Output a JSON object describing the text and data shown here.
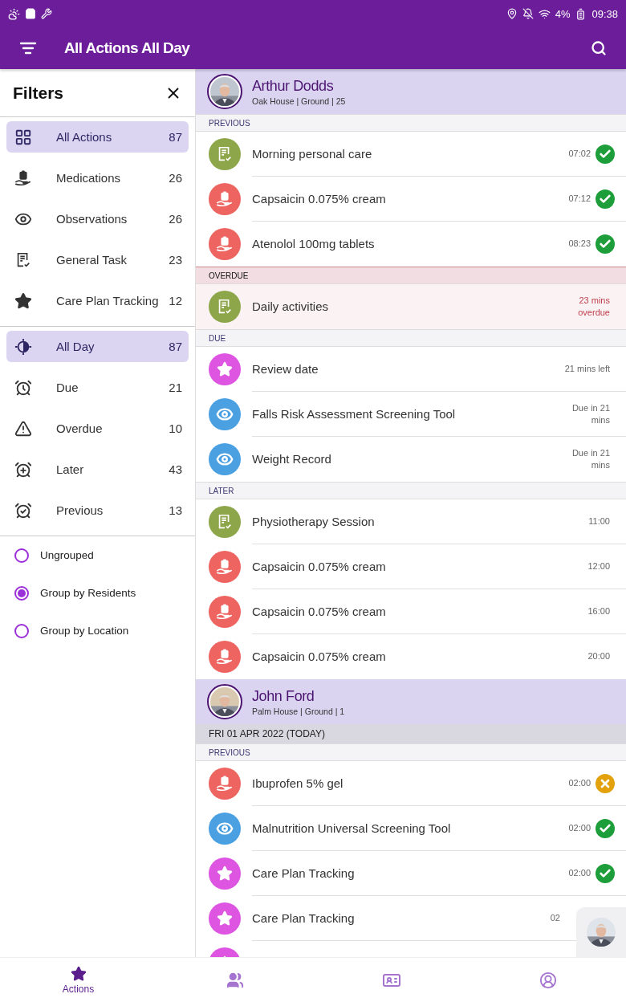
{
  "status_bar": {
    "battery": "4%",
    "time": "09:38"
  },
  "app_bar": {
    "title": "All Actions All Day"
  },
  "filters": {
    "title": "Filters",
    "type_filters": [
      {
        "kind": "all",
        "label": "All Actions",
        "count": "87",
        "selected": true
      },
      {
        "kind": "medication",
        "label": "Medications",
        "count": "26",
        "selected": false
      },
      {
        "kind": "observation",
        "label": "Observations",
        "count": "26",
        "selected": false
      },
      {
        "kind": "task",
        "label": "General Task",
        "count": "23",
        "selected": false
      },
      {
        "kind": "tracking",
        "label": "Care Plan Tracking",
        "count": "12",
        "selected": false
      }
    ],
    "time_filters": [
      {
        "kind": "allday",
        "label": "All Day",
        "count": "87",
        "selected": true
      },
      {
        "kind": "due",
        "label": "Due",
        "count": "21",
        "selected": false
      },
      {
        "kind": "overdue",
        "label": "Overdue",
        "count": "10",
        "selected": false
      },
      {
        "kind": "later",
        "label": "Later",
        "count": "43",
        "selected": false
      },
      {
        "kind": "previous",
        "label": "Previous",
        "count": "13",
        "selected": false
      }
    ],
    "grouping": [
      {
        "label": "Ungrouped",
        "selected": false
      },
      {
        "label": "Group by Residents",
        "selected": true
      },
      {
        "label": "Group by Location",
        "selected": false
      }
    ]
  },
  "residents": [
    {
      "name": "Arthur Dodds",
      "location": "Oak House | Ground | 25",
      "sections": [
        {
          "label": "PREVIOUS",
          "kind": "previous",
          "items": [
            {
              "kind": "task",
              "title": "Morning personal care",
              "time": "07:02",
              "completed": true
            },
            {
              "kind": "medication",
              "title": "Capsaicin 0.075% cream",
              "time": "07:12",
              "completed": true
            },
            {
              "kind": "medication",
              "title": "Atenolol 100mg tablets",
              "time": "08:23",
              "completed": true
            }
          ]
        },
        {
          "label": "OVERDUE",
          "kind": "overdue",
          "items": [
            {
              "kind": "task",
              "title": "Daily activities",
              "time": "23 mins overdue"
            }
          ]
        },
        {
          "label": "DUE",
          "kind": "due",
          "items": [
            {
              "kind": "tracking",
              "title": "Review date",
              "time": "21 mins left"
            },
            {
              "kind": "observation",
              "title": "Falls Risk Assessment Screening Tool",
              "time": "Due in 21 mins"
            },
            {
              "kind": "observation",
              "title": "Weight Record",
              "time": "Due in 21 mins"
            }
          ]
        },
        {
          "label": "LATER",
          "kind": "later",
          "items": [
            {
              "kind": "task",
              "title": "Physiotherapy Session",
              "time": "11:00"
            },
            {
              "kind": "medication",
              "title": "Capsaicin 0.075% cream",
              "time": "12:00"
            },
            {
              "kind": "medication",
              "title": "Capsaicin 0.075% cream",
              "time": "16:00"
            },
            {
              "kind": "medication",
              "title": "Capsaicin 0.075% cream",
              "time": "20:00"
            }
          ]
        }
      ]
    },
    {
      "name": "John Ford",
      "location": "Palm House | Ground | 1",
      "date": "FRI 01 APR 2022 (TODAY)",
      "sections": [
        {
          "label": "PREVIOUS",
          "kind": "previous",
          "items": [
            {
              "kind": "medication",
              "title": "Ibuprofen 5% gel",
              "time": "02:00",
              "completed": false
            },
            {
              "kind": "observation",
              "title": "Malnutrition Universal Screening Tool",
              "time": "02:00",
              "completed": true
            },
            {
              "kind": "tracking",
              "title": "Care Plan Tracking",
              "time": "02:00",
              "completed": true
            },
            {
              "kind": "tracking",
              "title": "Care Plan Tracking",
              "time": "02"
            },
            {
              "kind": "tracking"
            }
          ]
        }
      ]
    }
  ],
  "bottom_nav": [
    {
      "kind": "actions",
      "label": "Actions",
      "selected": true
    },
    {
      "kind": "residents",
      "selected": false
    },
    {
      "kind": "card",
      "selected": false
    },
    {
      "kind": "account",
      "selected": false
    }
  ]
}
